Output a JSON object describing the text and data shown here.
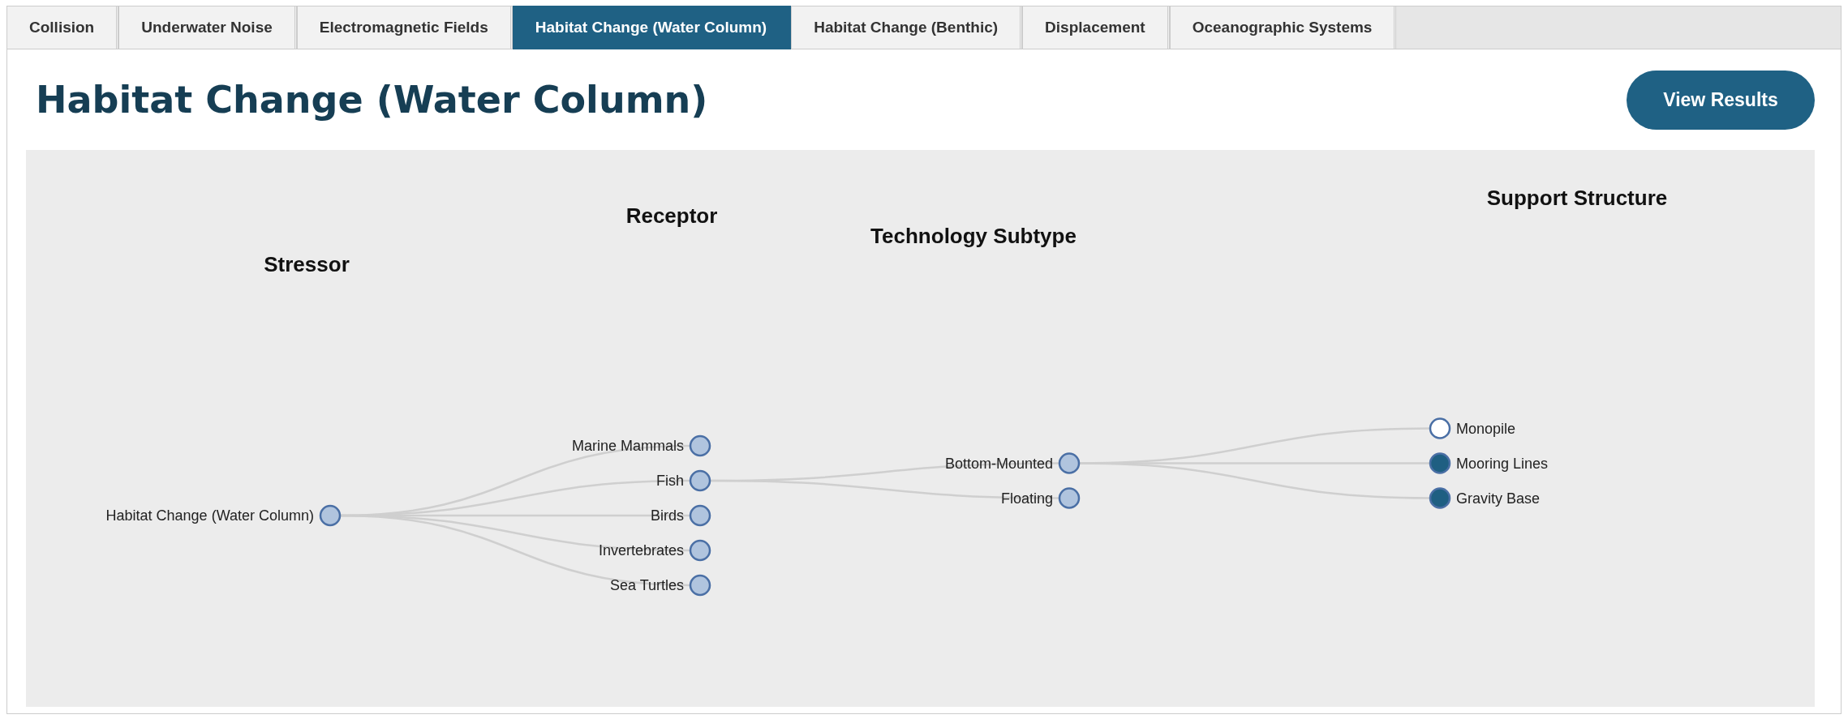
{
  "tabs": [
    {
      "label": "Collision",
      "selected": false
    },
    {
      "label": "Underwater Noise",
      "selected": false
    },
    {
      "label": "Electromagnetic Fields",
      "selected": false
    },
    {
      "label": "Habitat Change (Water Column)",
      "selected": true
    },
    {
      "label": "Habitat Change (Benthic)",
      "selected": false
    },
    {
      "label": "Displacement",
      "selected": false
    },
    {
      "label": "Oceanographic Systems",
      "selected": false
    }
  ],
  "title": "Habitat Change (Water Column)",
  "view_results_button": "View Results",
  "tree": {
    "levels": [
      "Stressor",
      "Receptor",
      "Technology Subtype",
      "Support Structure"
    ],
    "root": {
      "label": "Habitat Change (Water Column)",
      "children": [
        {
          "label": "Marine Mammals"
        },
        {
          "label": "Fish",
          "children": [
            {
              "label": "Bottom-Mounted",
              "children": [
                {
                  "label": "Monopile",
                  "selected": false
                },
                {
                  "label": "Mooring Lines",
                  "selected": true
                },
                {
                  "label": "Gravity Base",
                  "selected": true
                }
              ]
            },
            {
              "label": "Floating"
            }
          ]
        },
        {
          "label": "Birds"
        },
        {
          "label": "Invertebrates"
        },
        {
          "label": "Sea Turtles"
        }
      ]
    }
  }
}
